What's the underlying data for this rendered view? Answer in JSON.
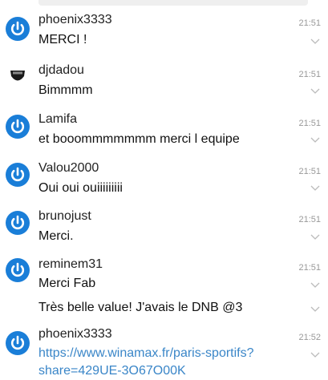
{
  "messages": [
    {
      "author": "phoenix3333",
      "time": "21:51",
      "lines": [
        "MERCI !"
      ],
      "avatar": "power-icon"
    },
    {
      "author": "djdadou",
      "time": "21:51",
      "lines": [
        "Bimmmm"
      ],
      "avatar": "team-badge-icon"
    },
    {
      "author": "Lamifa",
      "time": "21:51",
      "lines": [
        "et booommmmmmm merci l equipe"
      ],
      "avatar": "power-icon"
    },
    {
      "author": "Valou2000",
      "time": "21:51",
      "lines": [
        "Oui oui ouiiiiiiiii"
      ],
      "avatar": "power-icon"
    },
    {
      "author": "brunojust",
      "time": "21:51",
      "lines": [
        "Merci."
      ],
      "avatar": "power-icon"
    },
    {
      "author": "reminem31",
      "time": "21:51",
      "lines": [
        "Merci Fab",
        "Très belle value! J'avais le DNB @3"
      ],
      "avatar": "power-icon"
    },
    {
      "author": "phoenix3333",
      "time": "21:52",
      "link": [
        "https://www.winamax.fr/paris-sportifs?",
        "share=429UE-3O67O00K"
      ],
      "avatar": "power-icon"
    }
  ],
  "colors": {
    "avatar_blue": "#1a7ed8",
    "link": "#3a86c8",
    "time": "#999999"
  }
}
